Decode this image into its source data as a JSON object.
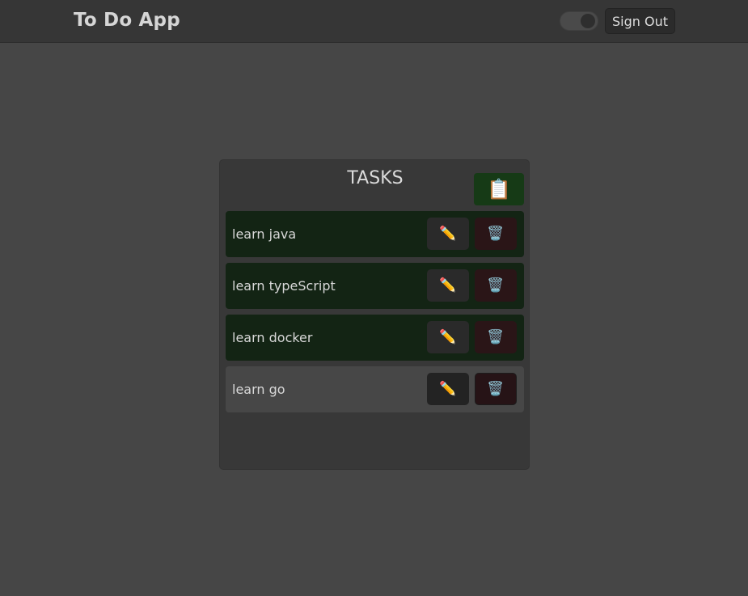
{
  "navbar": {
    "brand": "To Do App",
    "sign_out_label": "Sign Out",
    "theme_toggle": {
      "state": "on"
    }
  },
  "panel": {
    "title": "TASKS",
    "add_icon": "clipboard-icon",
    "add_glyph": "📋"
  },
  "tasks": [
    {
      "label": "learn java",
      "completed": true
    },
    {
      "label": "learn typeScript",
      "completed": true
    },
    {
      "label": "learn docker",
      "completed": true
    },
    {
      "label": "learn go",
      "completed": false
    }
  ],
  "icons": {
    "edit": "✏️",
    "delete": "🗑️"
  },
  "colors": {
    "background": "#464646",
    "navbar": "#363636",
    "panel": "#383838",
    "task_done": "#132414",
    "task_pending": "#474747",
    "add_button": "#163a16",
    "delete_button": "#2a1517"
  }
}
